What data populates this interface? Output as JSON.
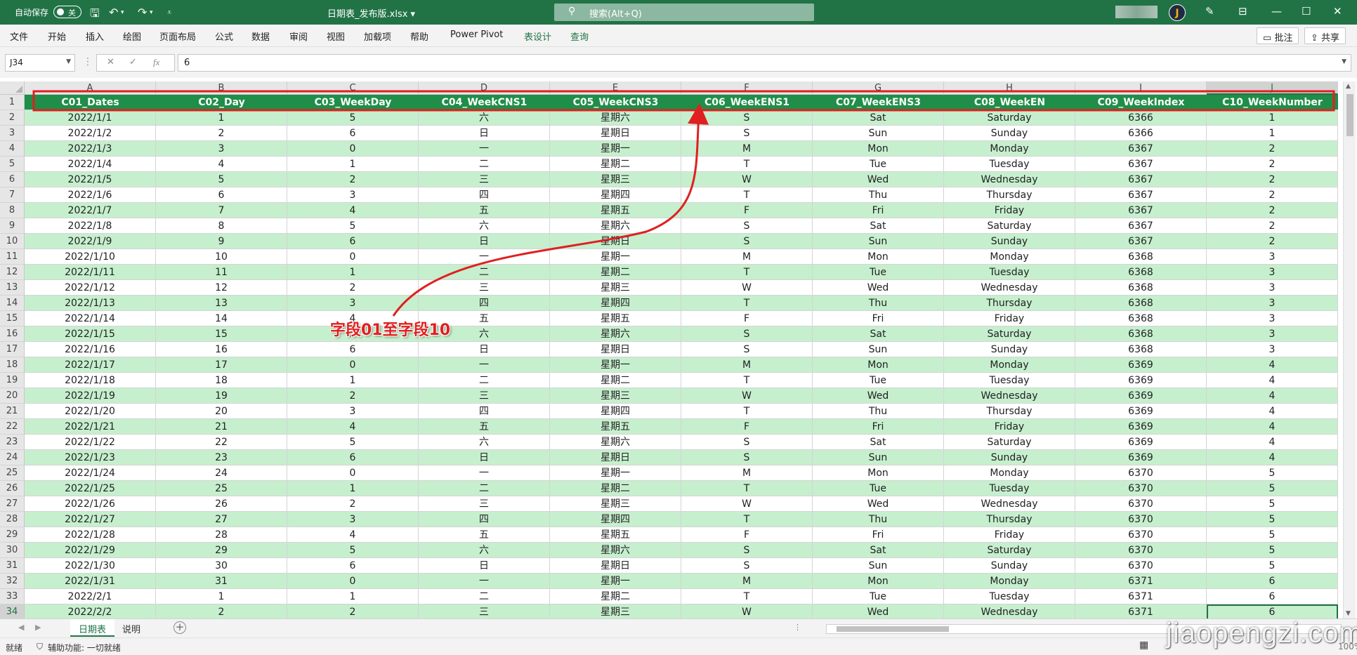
{
  "titlebar": {
    "autosave_label": "自动保存",
    "autosave_state": "关",
    "document_title": "日期表_发布版.xlsx",
    "search_placeholder": "搜索(Alt+Q)",
    "avatar_initial": "J"
  },
  "menu": {
    "items": [
      "文件",
      "开始",
      "插入",
      "绘图",
      "页面布局",
      "公式",
      "数据",
      "审阅",
      "视图",
      "加载项",
      "帮助",
      "Power Pivot",
      "表设计",
      "查询"
    ],
    "comments_label": "批注",
    "share_label": "共享"
  },
  "formula_bar": {
    "name_box": "J34",
    "formula_value": "6",
    "fx_label": "fx"
  },
  "sheet": {
    "column_letters": [
      "A",
      "B",
      "C",
      "D",
      "E",
      "F",
      "G",
      "H",
      "I",
      "J"
    ],
    "selected_column": "J",
    "selected_row": 34,
    "headers": [
      "C01_Dates",
      "C02_Day",
      "C03_WeekDay",
      "C04_WeekCNS1",
      "C05_WeekCNS3",
      "C06_WeekENS1",
      "C07_WeekENS3",
      "C08_WeekEN",
      "C09_WeekIndex",
      "C10_WeekNumber"
    ],
    "rows": [
      [
        "2022/1/1",
        "1",
        "5",
        "六",
        "星期六",
        "S",
        "Sat",
        "Saturday",
        "6366",
        "1"
      ],
      [
        "2022/1/2",
        "2",
        "6",
        "日",
        "星期日",
        "S",
        "Sun",
        "Sunday",
        "6366",
        "1"
      ],
      [
        "2022/1/3",
        "3",
        "0",
        "一",
        "星期一",
        "M",
        "Mon",
        "Monday",
        "6367",
        "2"
      ],
      [
        "2022/1/4",
        "4",
        "1",
        "二",
        "星期二",
        "T",
        "Tue",
        "Tuesday",
        "6367",
        "2"
      ],
      [
        "2022/1/5",
        "5",
        "2",
        "三",
        "星期三",
        "W",
        "Wed",
        "Wednesday",
        "6367",
        "2"
      ],
      [
        "2022/1/6",
        "6",
        "3",
        "四",
        "星期四",
        "T",
        "Thu",
        "Thursday",
        "6367",
        "2"
      ],
      [
        "2022/1/7",
        "7",
        "4",
        "五",
        "星期五",
        "F",
        "Fri",
        "Friday",
        "6367",
        "2"
      ],
      [
        "2022/1/8",
        "8",
        "5",
        "六",
        "星期六",
        "S",
        "Sat",
        "Saturday",
        "6367",
        "2"
      ],
      [
        "2022/1/9",
        "9",
        "6",
        "日",
        "星期日",
        "S",
        "Sun",
        "Sunday",
        "6367",
        "2"
      ],
      [
        "2022/1/10",
        "10",
        "0",
        "一",
        "星期一",
        "M",
        "Mon",
        "Monday",
        "6368",
        "3"
      ],
      [
        "2022/1/11",
        "11",
        "1",
        "二",
        "星期二",
        "T",
        "Tue",
        "Tuesday",
        "6368",
        "3"
      ],
      [
        "2022/1/12",
        "12",
        "2",
        "三",
        "星期三",
        "W",
        "Wed",
        "Wednesday",
        "6368",
        "3"
      ],
      [
        "2022/1/13",
        "13",
        "3",
        "四",
        "星期四",
        "T",
        "Thu",
        "Thursday",
        "6368",
        "3"
      ],
      [
        "2022/1/14",
        "14",
        "4",
        "五",
        "星期五",
        "F",
        "Fri",
        "Friday",
        "6368",
        "3"
      ],
      [
        "2022/1/15",
        "15",
        "5",
        "六",
        "星期六",
        "S",
        "Sat",
        "Saturday",
        "6368",
        "3"
      ],
      [
        "2022/1/16",
        "16",
        "6",
        "日",
        "星期日",
        "S",
        "Sun",
        "Sunday",
        "6368",
        "3"
      ],
      [
        "2022/1/17",
        "17",
        "0",
        "一",
        "星期一",
        "M",
        "Mon",
        "Monday",
        "6369",
        "4"
      ],
      [
        "2022/1/18",
        "18",
        "1",
        "二",
        "星期二",
        "T",
        "Tue",
        "Tuesday",
        "6369",
        "4"
      ],
      [
        "2022/1/19",
        "19",
        "2",
        "三",
        "星期三",
        "W",
        "Wed",
        "Wednesday",
        "6369",
        "4"
      ],
      [
        "2022/1/20",
        "20",
        "3",
        "四",
        "星期四",
        "T",
        "Thu",
        "Thursday",
        "6369",
        "4"
      ],
      [
        "2022/1/21",
        "21",
        "4",
        "五",
        "星期五",
        "F",
        "Fri",
        "Friday",
        "6369",
        "4"
      ],
      [
        "2022/1/22",
        "22",
        "5",
        "六",
        "星期六",
        "S",
        "Sat",
        "Saturday",
        "6369",
        "4"
      ],
      [
        "2022/1/23",
        "23",
        "6",
        "日",
        "星期日",
        "S",
        "Sun",
        "Sunday",
        "6369",
        "4"
      ],
      [
        "2022/1/24",
        "24",
        "0",
        "一",
        "星期一",
        "M",
        "Mon",
        "Monday",
        "6370",
        "5"
      ],
      [
        "2022/1/25",
        "25",
        "1",
        "二",
        "星期二",
        "T",
        "Tue",
        "Tuesday",
        "6370",
        "5"
      ],
      [
        "2022/1/26",
        "26",
        "2",
        "三",
        "星期三",
        "W",
        "Wed",
        "Wednesday",
        "6370",
        "5"
      ],
      [
        "2022/1/27",
        "27",
        "3",
        "四",
        "星期四",
        "T",
        "Thu",
        "Thursday",
        "6370",
        "5"
      ],
      [
        "2022/1/28",
        "28",
        "4",
        "五",
        "星期五",
        "F",
        "Fri",
        "Friday",
        "6370",
        "5"
      ],
      [
        "2022/1/29",
        "29",
        "5",
        "六",
        "星期六",
        "S",
        "Sat",
        "Saturday",
        "6370",
        "5"
      ],
      [
        "2022/1/30",
        "30",
        "6",
        "日",
        "星期日",
        "S",
        "Sun",
        "Sunday",
        "6370",
        "5"
      ],
      [
        "2022/1/31",
        "31",
        "0",
        "一",
        "星期一",
        "M",
        "Mon",
        "Monday",
        "6371",
        "6"
      ],
      [
        "2022/2/1",
        "1",
        "1",
        "二",
        "星期二",
        "T",
        "Tue",
        "Tuesday",
        "6371",
        "6"
      ],
      [
        "2022/2/2",
        "2",
        "2",
        "三",
        "星期三",
        "W",
        "Wed",
        "Wednesday",
        "6371",
        "6"
      ]
    ]
  },
  "tabs": {
    "sheets": [
      "日期表",
      "说明"
    ],
    "active": "日期表"
  },
  "status": {
    "ready": "就绪",
    "accessibility": "辅助功能: 一切就绪",
    "zoom": "100%"
  },
  "annotation": {
    "label": "字段01至字段10"
  },
  "watermark": "jiaopengzi.com",
  "colors": {
    "excel_green": "#217346",
    "header_fill": "#1f8e48",
    "band_fill": "#c6efce",
    "annotation_red": "#e02020"
  }
}
